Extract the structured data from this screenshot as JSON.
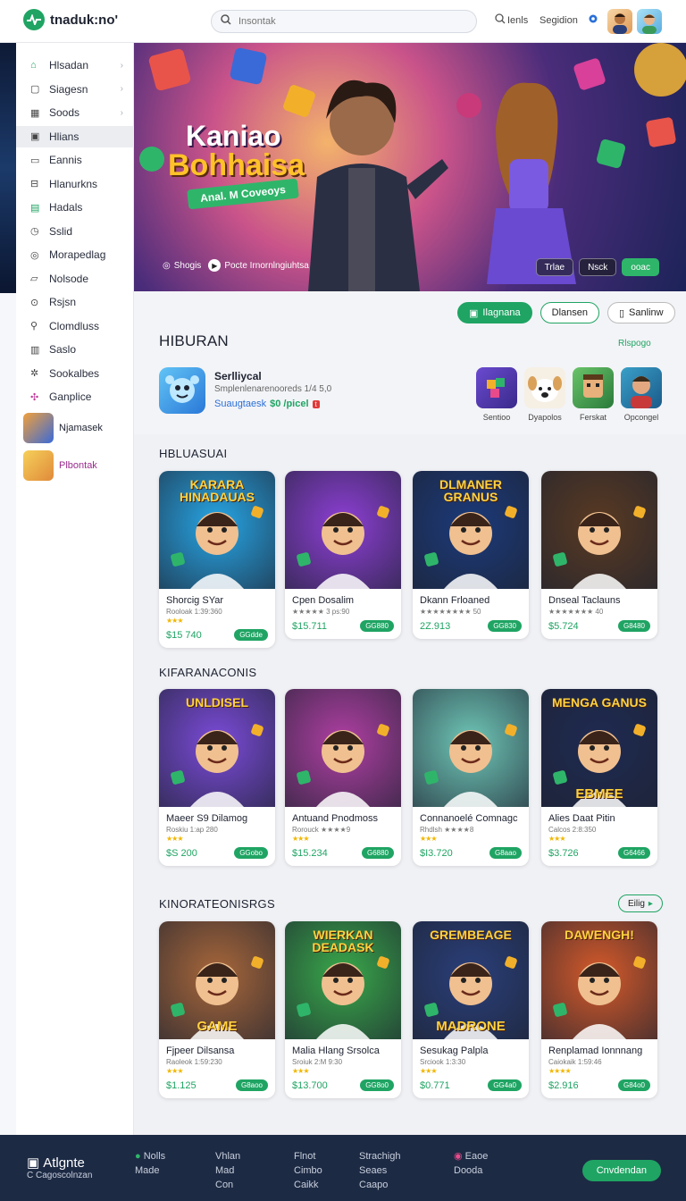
{
  "header": {
    "logo_text": "tnaduk:no'",
    "search_placeholder": "Insontak",
    "links": [
      "Ienls",
      "Segidion"
    ]
  },
  "sidebar": {
    "items": [
      {
        "label": "Hlsadan",
        "icon": "home-icon",
        "chevron": true
      },
      {
        "label": "Siagesn",
        "icon": "square-icon",
        "chevron": true
      },
      {
        "label": "Soods",
        "icon": "grid-icon",
        "chevron": true
      },
      {
        "label": "Hlians",
        "icon": "games-icon",
        "chevron": false,
        "active": true
      },
      {
        "label": "Eannis",
        "icon": "tv-icon",
        "chevron": false
      },
      {
        "label": "Hlanurkns",
        "icon": "bookmark-icon",
        "chevron": false
      },
      {
        "label": "Hadals",
        "icon": "bag-icon",
        "chevron": false
      },
      {
        "label": "Sslid",
        "icon": "clock-icon",
        "chevron": false
      },
      {
        "label": "Morapedlag",
        "icon": "compass-icon",
        "chevron": false
      },
      {
        "label": "Nolsode",
        "icon": "folder-icon",
        "chevron": false
      },
      {
        "label": "Rsjsn",
        "icon": "help-icon",
        "chevron": false
      },
      {
        "label": "Clomdluss",
        "icon": "user-icon",
        "chevron": false
      },
      {
        "label": "Saslo",
        "icon": "chart-icon",
        "chevron": false
      },
      {
        "label": "Sookalbes",
        "icon": "gear-icon",
        "chevron": false
      },
      {
        "label": "Ganplice",
        "icon": "puzzle-icon",
        "chevron": false
      }
    ],
    "users": [
      {
        "label": "Njamasek",
        "color": "#1d2230"
      },
      {
        "label": "Plbontak",
        "color": "#9b2c8f"
      }
    ]
  },
  "hero": {
    "title_line1": "Kaniao",
    "title_line2": "Bohhaisa",
    "ribbon": "Anal. M Coveoys",
    "cta_left": "Shogis",
    "cta_play": "Pocte Irnornlngiuhtsa",
    "tabs": [
      "Trlae",
      "Nsck",
      "ooac"
    ]
  },
  "filters": [
    "Ilagnana",
    "Dlansen",
    "Sanlinw"
  ],
  "hiburan": {
    "title": "HIBURAN",
    "link": "Rlspogo",
    "featured": {
      "name": "Serlliycal",
      "subtitle": "Smplenlenarenooreds 1/4 5,0",
      "meta_a": "Suaugtaesk",
      "meta_b": "$0 /picel",
      "badge": "t"
    },
    "mini_apps": [
      "Sentioo",
      "Dyapolos",
      "Ferskat",
      "Opcongel"
    ]
  },
  "sections": [
    {
      "title": "HBLUASUAI",
      "cards": [
        {
          "cap_top": "KARARA HINADAUAS",
          "name": "Shorcig SYar",
          "sub": "Rooloak 1:39:360",
          "stars": "★★★",
          "price": "$15 740",
          "btn": "GGdde",
          "bg": "#27a6e6"
        },
        {
          "cap_top": "",
          "name": "Cpen Dosalim",
          "sub": "★★★★★ 3 ps:90",
          "stars": "",
          "price": "$15.711",
          "btn": "GG880",
          "bg": "#8e3fd6"
        },
        {
          "cap_top": "DLMANER GRANUS",
          "name": "Dkann Frloaned",
          "sub": "★★★★★★★★ 50",
          "stars": "",
          "price": "2Z.913",
          "btn": "GG830",
          "bg": "#1b3a7a"
        },
        {
          "cap_top": "",
          "name": "Dnseal Taclauns",
          "sub": "★★★★★★★ 40",
          "stars": "",
          "price": "$5.724",
          "btn": "G8480",
          "bg": "#5a3a22"
        }
      ]
    },
    {
      "title": "KIFARANACONIS",
      "cards": [
        {
          "cap_top": "UNLDISEL",
          "name": "Maeer S9 Dilamog",
          "sub": "Roskiu 1:ap 280",
          "stars": "★★★",
          "price": "$S 200",
          "btn": "GGobo",
          "bg": "#7b4bd9"
        },
        {
          "cap_top": "",
          "name": "Antuand Pnodmoss",
          "sub": "Rorouck ★★★★9",
          "stars": "★★★",
          "price": "$15.234",
          "btn": "G6880",
          "bg": "#b03fa3"
        },
        {
          "cap_top": "",
          "name": "Connanoelé Comnagc",
          "sub": "Rhdlsh ★★★★8",
          "stars": "★★★",
          "price": "$I3.720",
          "btn": "G8aao",
          "bg": "#6fc7b8"
        },
        {
          "cap_top": "MENGA GANUS",
          "name": "Alies Daat Pitin",
          "sub": "Calcos 2:8:350",
          "stars": "★★★",
          "price": "$3.726",
          "btn": "G6466",
          "bg": "#1f2a52",
          "cap_bottom": "EBMEE"
        }
      ]
    },
    {
      "title": "KINORATEONISRGS",
      "link": "Eilig",
      "cards": [
        {
          "cap_top": "",
          "name": "Fjpeer Dilsansa",
          "sub": "Raoleok 1:59:230",
          "stars": "★★★",
          "price": "$1.125",
          "btn": "G8aoo",
          "bg": "#a8673a",
          "cap_bottom": "GAME"
        },
        {
          "cap_top": "WIERKAN DEADASK",
          "name": "Malia Hlang Srsolca",
          "sub": "Sroiuk 2:M 9:30",
          "stars": "★★★",
          "price": "$13.700",
          "btn": "GG8o0",
          "bg": "#39a94a"
        },
        {
          "cap_top": "GREMBEAGE",
          "name": "Sesukag Palpla",
          "sub": "Srciook 1:3:30",
          "stars": "★★★",
          "price": "$0.771",
          "btn": "GG4a0",
          "bg": "#2a3f7a",
          "cap_bottom": "MADRONE"
        },
        {
          "cap_top": "DAWENGH!",
          "name": "Renplamad Ionnnang",
          "sub": "Caiokaik 1:59:46",
          "stars": "★★★★",
          "price": "$2.916",
          "btn": "G84o0",
          "bg": "#d65a2a"
        }
      ]
    }
  ],
  "footer": {
    "brand": "Atlgnte",
    "brand_sub": "C Cagoscolnzan",
    "col1": [
      "Nolls",
      "Made"
    ],
    "col2": [
      "Vhlan",
      "Mad",
      "Con"
    ],
    "col3": [
      "Flnot",
      "Cimbo",
      "Caikk"
    ],
    "col4": [
      "Strachigh",
      "Seaes",
      "Caapo"
    ],
    "col5": [
      "Eaoe",
      "Dooda"
    ],
    "cta": "Cnvdendan"
  }
}
